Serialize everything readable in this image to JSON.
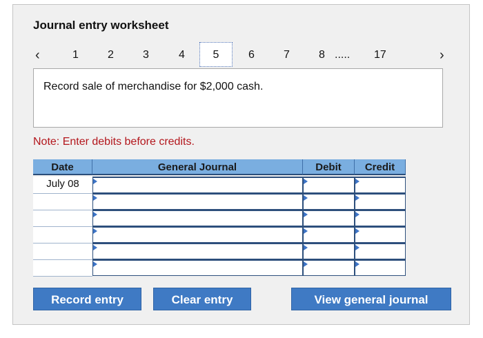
{
  "worksheet": {
    "title": "Journal entry worksheet",
    "pager": {
      "prev_icon": "‹",
      "next_icon": "›",
      "pages": [
        "1",
        "2",
        "3",
        "4",
        "5",
        "6",
        "7",
        "8"
      ],
      "active_page": "5",
      "ellipsis": ".....",
      "last_page": "17"
    },
    "description": "Record sale of merchandise for $2,000 cash.",
    "note": "Note: Enter debits before credits."
  },
  "journal": {
    "columns": {
      "date": "Date",
      "general_journal": "General Journal",
      "debit": "Debit",
      "credit": "Credit"
    },
    "rows": [
      {
        "date": "July 08",
        "account": "",
        "debit": "",
        "credit": ""
      },
      {
        "date": "",
        "account": "",
        "debit": "",
        "credit": ""
      },
      {
        "date": "",
        "account": "",
        "debit": "",
        "credit": ""
      },
      {
        "date": "",
        "account": "",
        "debit": "",
        "credit": ""
      },
      {
        "date": "",
        "account": "",
        "debit": "",
        "credit": ""
      },
      {
        "date": "",
        "account": "",
        "debit": "",
        "credit": ""
      }
    ]
  },
  "buttons": {
    "record": "Record entry",
    "clear": "Clear entry",
    "view": "View general journal"
  },
  "colors": {
    "header_bg": "#7aaee0",
    "button_bg": "#3f7ac4",
    "note_text": "#b3161c",
    "panel_bg": "#f0f0f0"
  }
}
